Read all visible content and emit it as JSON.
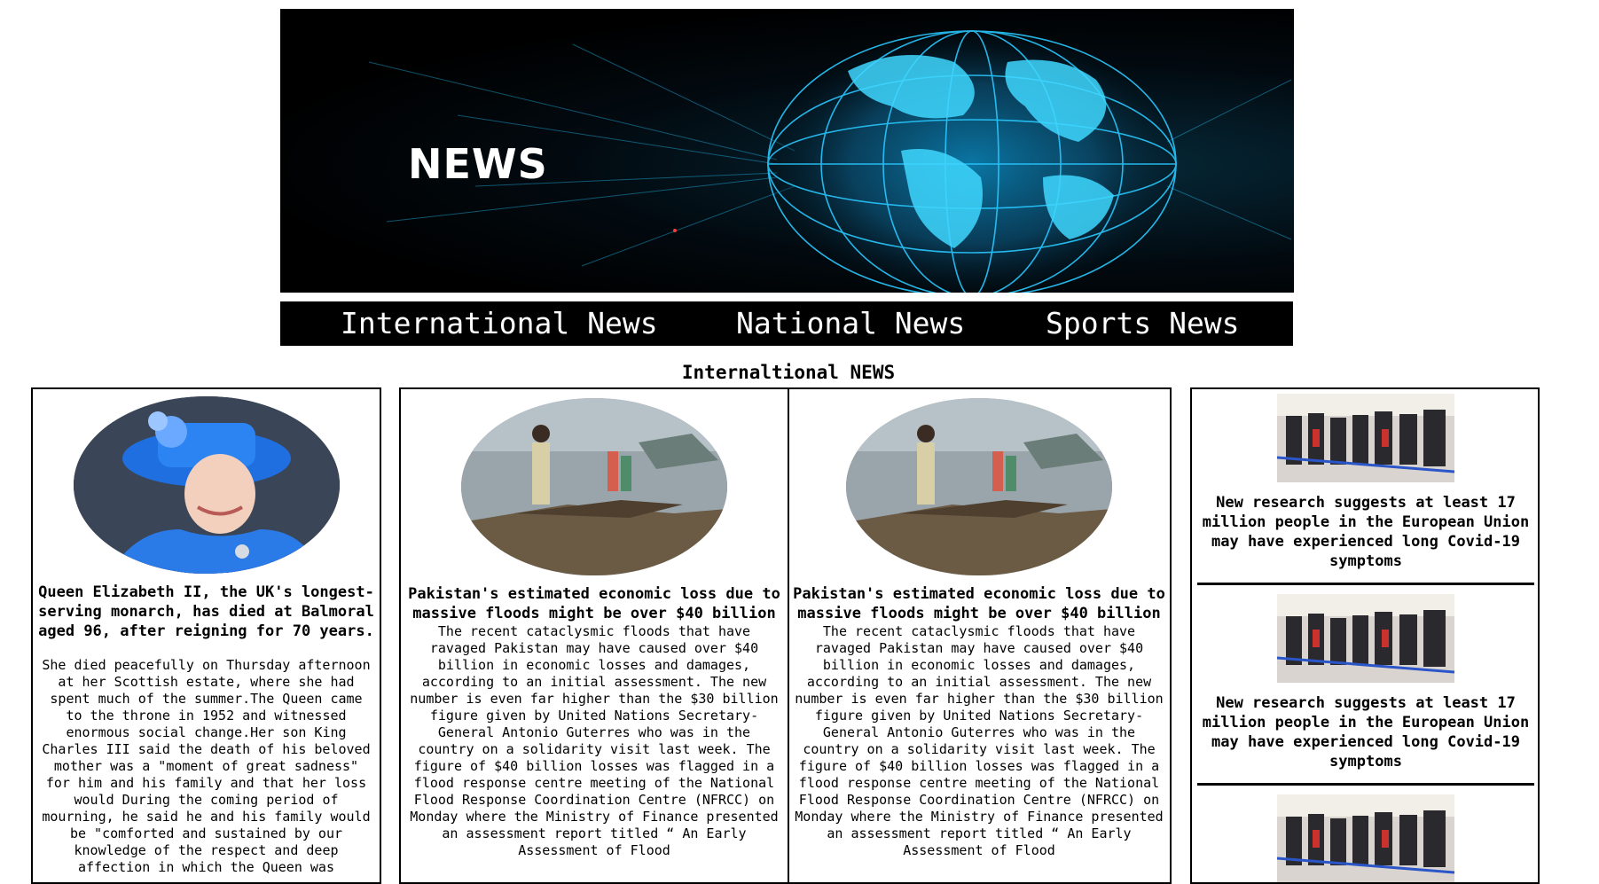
{
  "banner": {
    "title": "NEWS"
  },
  "nav": {
    "items": [
      {
        "label": "International News"
      },
      {
        "label": "National News"
      },
      {
        "label": "Sports News"
      }
    ]
  },
  "section": {
    "heading": "Internaltional NEWS"
  },
  "left_article": {
    "headline": "Queen Elizabeth II, the UK's longest-serving monarch, has died at Balmoral aged 96, after reigning for 70 years.",
    "body": "She died peacefully on Thursday afternoon at her Scottish estate, where she had spent much of the summer.The Queen came to the throne in 1952 and witnessed enormous social change.Her son King Charles III said the death of his beloved mother was a \"moment of great sadness\" for him and his family and that her loss would During the coming period of mourning, he said he and his family would be \"comforted and sustained by our knowledge of the respect and deep affection in which the Queen was"
  },
  "mid_articles": [
    {
      "headline": "Pakistan's estimated economic loss due to massive floods might be over $40 billion",
      "body": "The recent cataclysmic floods that have ravaged Pakistan may have caused over $40 billion in economic losses and damages, according to an initial assessment. The new number is even far higher than the $30 billion figure given by United Nations Secretary-General Antonio Guterres who was in the country on a solidarity visit last week. The figure of $40 billion losses was flagged in a flood response centre meeting of the National Flood Response Coordination Centre (NFRCC) on Monday where the Ministry of Finance presented an assessment report titled “ An Early Assessment of Flood"
    },
    {
      "headline": "Pakistan's estimated economic loss due to massive floods might be over $40 billion",
      "body": "The recent cataclysmic floods that have ravaged Pakistan may have caused over $40 billion in economic losses and damages, according to an initial assessment. The new number is even far higher than the $30 billion figure given by United Nations Secretary-General Antonio Guterres who was in the country on a solidarity visit last week. The figure of $40 billion losses was flagged in a flood response centre meeting of the National Flood Response Coordination Centre (NFRCC) on Monday where the Ministry of Finance presented an assessment report titled “ An Early Assessment of Flood"
    }
  ],
  "side_articles": [
    {
      "headline": "New research suggests at least 17 million people in the European Union may have experienced long Covid-19 symptoms"
    },
    {
      "headline": "New research suggests at least 17 million people in the European Union may have experienced long Covid-19 symptoms"
    },
    {
      "headline": ""
    }
  ]
}
